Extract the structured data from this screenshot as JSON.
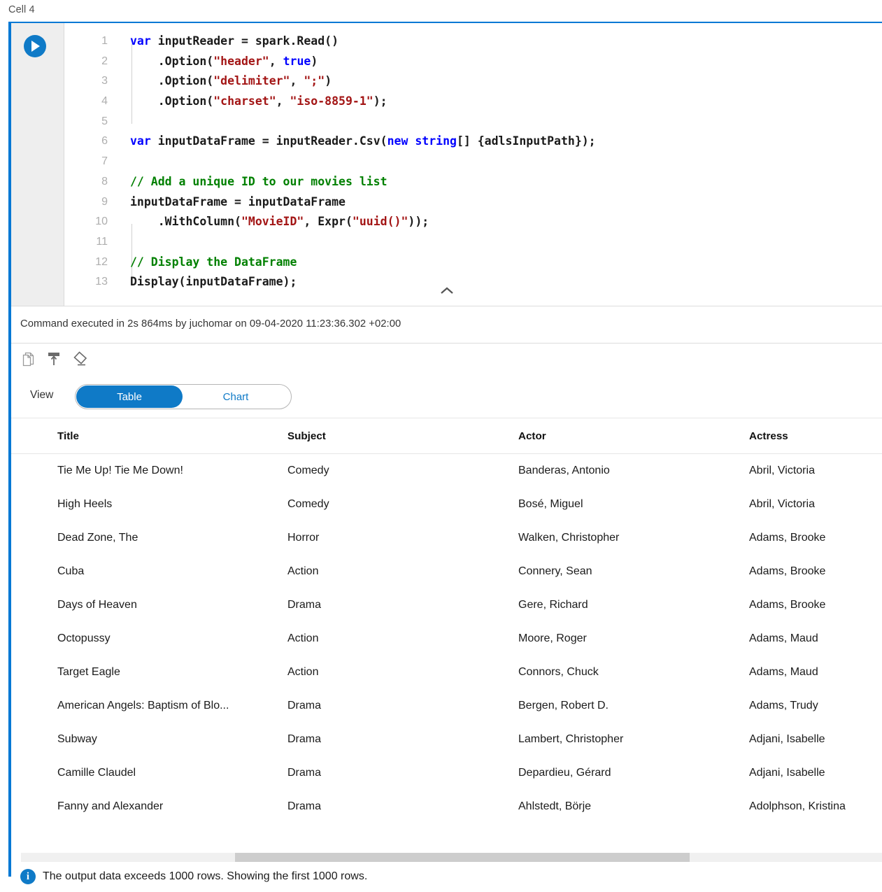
{
  "cell": {
    "label": "Cell 4",
    "run_icon": "play-icon",
    "collapse_icon": "chevron-up-icon"
  },
  "code": {
    "lines": [
      {
        "n": "1",
        "tokens": [
          {
            "t": "var",
            "c": "kw"
          },
          {
            "t": " inputReader = spark.Read()",
            "c": ""
          }
        ]
      },
      {
        "n": "2",
        "tokens": [
          {
            "t": "    .Option(",
            "c": ""
          },
          {
            "t": "\"header\"",
            "c": "str"
          },
          {
            "t": ", ",
            "c": ""
          },
          {
            "t": "true",
            "c": "kw"
          },
          {
            "t": ")",
            "c": ""
          }
        ]
      },
      {
        "n": "3",
        "tokens": [
          {
            "t": "    .Option(",
            "c": ""
          },
          {
            "t": "\"delimiter\"",
            "c": "str"
          },
          {
            "t": ", ",
            "c": ""
          },
          {
            "t": "\";\"",
            "c": "str"
          },
          {
            "t": ")",
            "c": ""
          }
        ]
      },
      {
        "n": "4",
        "tokens": [
          {
            "t": "    .Option(",
            "c": ""
          },
          {
            "t": "\"charset\"",
            "c": "str"
          },
          {
            "t": ", ",
            "c": ""
          },
          {
            "t": "\"iso-8859-1\"",
            "c": "str"
          },
          {
            "t": ");",
            "c": ""
          }
        ]
      },
      {
        "n": "5",
        "tokens": [
          {
            "t": "",
            "c": ""
          }
        ]
      },
      {
        "n": "6",
        "tokens": [
          {
            "t": "var",
            "c": "kw"
          },
          {
            "t": " inputDataFrame = inputReader.Csv(",
            "c": ""
          },
          {
            "t": "new",
            "c": "kw"
          },
          {
            "t": " ",
            "c": ""
          },
          {
            "t": "string",
            "c": "kw"
          },
          {
            "t": "[] {adlsInputPath});",
            "c": ""
          }
        ]
      },
      {
        "n": "7",
        "tokens": [
          {
            "t": "",
            "c": ""
          }
        ]
      },
      {
        "n": "8",
        "tokens": [
          {
            "t": "// Add a unique ID to our movies list",
            "c": "cmt"
          }
        ]
      },
      {
        "n": "9",
        "tokens": [
          {
            "t": "inputDataFrame = inputDataFrame",
            "c": ""
          }
        ]
      },
      {
        "n": "10",
        "tokens": [
          {
            "t": "    .WithColumn(",
            "c": ""
          },
          {
            "t": "\"MovieID\"",
            "c": "str"
          },
          {
            "t": ", Expr(",
            "c": ""
          },
          {
            "t": "\"uuid()\"",
            "c": "str"
          },
          {
            "t": "));",
            "c": ""
          }
        ]
      },
      {
        "n": "11",
        "tokens": [
          {
            "t": "",
            "c": ""
          }
        ]
      },
      {
        "n": "12",
        "tokens": [
          {
            "t": "// Display the DataFrame",
            "c": "cmt"
          }
        ]
      },
      {
        "n": "13",
        "tokens": [
          {
            "t": "Display(inputDataFrame);",
            "c": ""
          }
        ]
      }
    ]
  },
  "status": {
    "text": "Command executed in 2s 864ms by juchomar on 09-04-2020 11:23:36.302 +02:00"
  },
  "toolbar": {
    "icons": [
      {
        "name": "copy-icon",
        "title": "Copy"
      },
      {
        "name": "pin-icon",
        "title": "Move to top"
      },
      {
        "name": "clear-icon",
        "title": "Clear output"
      }
    ]
  },
  "view_switch": {
    "label": "View",
    "options": [
      "Table",
      "Chart"
    ],
    "selected": "Table"
  },
  "table": {
    "columns": [
      "Title",
      "Subject",
      "Actor",
      "Actress"
    ],
    "rows": [
      [
        "Tie Me Up! Tie Me Down!",
        "Comedy",
        "Banderas, Antonio",
        "Abril, Victoria"
      ],
      [
        "High Heels",
        "Comedy",
        "Bosé, Miguel",
        "Abril, Victoria"
      ],
      [
        "Dead Zone, The",
        "Horror",
        "Walken, Christopher",
        "Adams, Brooke"
      ],
      [
        "Cuba",
        "Action",
        "Connery, Sean",
        "Adams, Brooke"
      ],
      [
        "Days of Heaven",
        "Drama",
        "Gere, Richard",
        "Adams, Brooke"
      ],
      [
        "Octopussy",
        "Action",
        "Moore, Roger",
        "Adams, Maud"
      ],
      [
        "Target Eagle",
        "Action",
        "Connors, Chuck",
        "Adams, Maud"
      ],
      [
        "American Angels: Baptism of Blo...",
        "Drama",
        "Bergen, Robert D.",
        "Adams, Trudy"
      ],
      [
        "Subway",
        "Drama",
        "Lambert, Christopher",
        "Adjani, Isabelle"
      ],
      [
        "Camille Claudel",
        "Drama",
        "Depardieu, Gérard",
        "Adjani, Isabelle"
      ],
      [
        "Fanny and Alexander",
        "Drama",
        "Ahlstedt, Börje",
        "Adolphson, Kristina"
      ]
    ]
  },
  "footer": {
    "icon": "info-icon",
    "icon_glyph": "i",
    "text": "The output data exceeds 1000 rows. Showing the first 1000 rows."
  },
  "colors": {
    "accent": "#0078d4",
    "run_button": "#0f7ac7",
    "keyword": "#0000ff",
    "string": "#a31515",
    "comment": "#008000"
  }
}
